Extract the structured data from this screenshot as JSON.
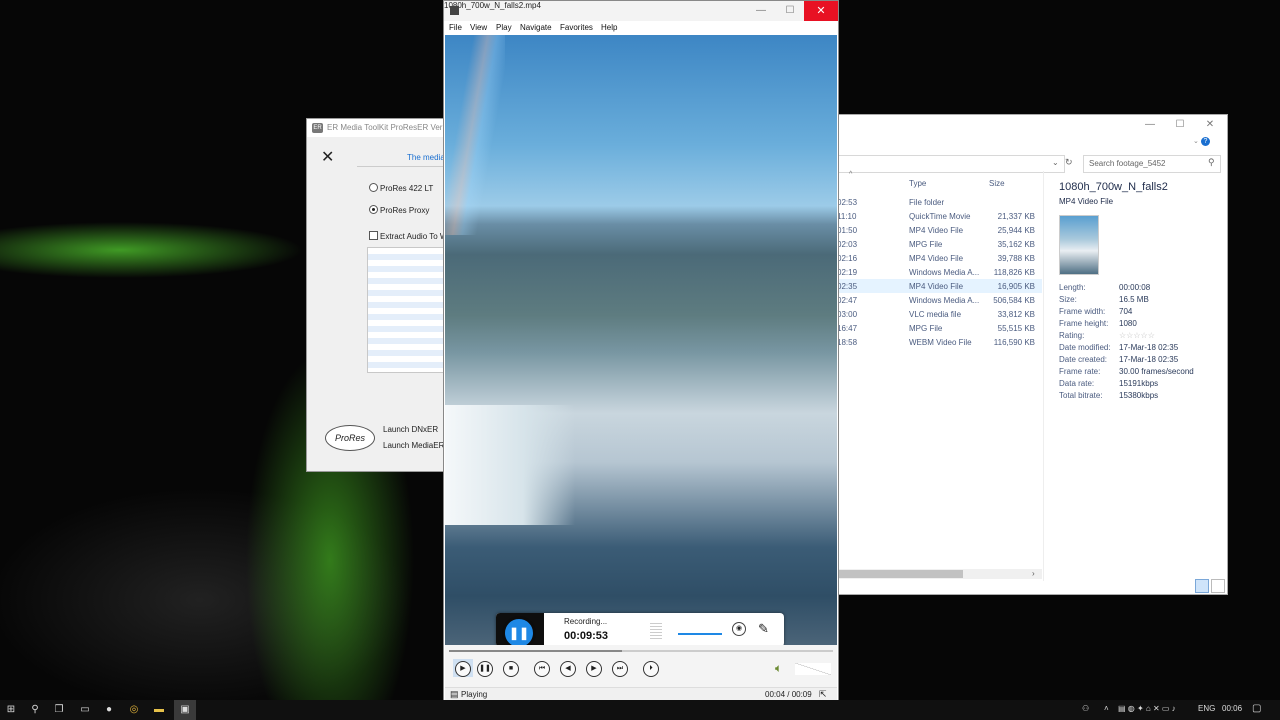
{
  "player": {
    "title": "1080h_700w_N_falls2.mp4",
    "menu": [
      "File",
      "View",
      "Play",
      "Navigate",
      "Favorites",
      "Help"
    ],
    "status": "Playing",
    "time": "00:04 / 00:09",
    "seek_progress": 0.45
  },
  "recorder": {
    "status": "Recording...",
    "elapsed": "00:09:53"
  },
  "er_toolkit": {
    "title": "ER Media ToolKit ProResER  Ver -",
    "subtitle": "The media",
    "options": [
      "ProRes 422 LT",
      "ProRes Proxy"
    ],
    "selected_option": "ProRes Proxy",
    "extract_audio_label": "Extract Audio To W",
    "logo_text": "ProRes",
    "launch_dnxer": "Launch DNxER",
    "launch_mediaer": "Launch MediaER"
  },
  "explorer": {
    "search_placeholder": "Search footage_5452",
    "columns": {
      "type": "Type",
      "size": "Size"
    },
    "rows": [
      {
        "date": "02:53",
        "type": "File folder",
        "size": ""
      },
      {
        "date": "11:10",
        "type": "QuickTime Movie",
        "size": "21,337 KB"
      },
      {
        "date": "01:50",
        "type": "MP4 Video File",
        "size": "25,944 KB"
      },
      {
        "date": "02:03",
        "type": "MPG File",
        "size": "35,162 KB"
      },
      {
        "date": "02:16",
        "type": "MP4 Video File",
        "size": "39,788 KB"
      },
      {
        "date": "02:19",
        "type": "Windows Media A...",
        "size": "118,826 KB"
      },
      {
        "date": "02:35",
        "type": "MP4 Video File",
        "size": "16,905 KB",
        "selected": true
      },
      {
        "date": "02:47",
        "type": "Windows Media A...",
        "size": "506,584 KB"
      },
      {
        "date": "03:00",
        "type": "VLC media file",
        "size": "33,812 KB"
      },
      {
        "date": "16:47",
        "type": "MPG File",
        "size": "55,515 KB"
      },
      {
        "date": "18:58",
        "type": "WEBM Video File",
        "size": "116,590 KB"
      }
    ],
    "details": {
      "file_name": "1080h_700w_N_falls2",
      "file_type": "MP4 Video File",
      "properties": [
        {
          "label": "Length:",
          "value": "00:00:08"
        },
        {
          "label": "Size:",
          "value": "16.5 MB"
        },
        {
          "label": "Frame width:",
          "value": "704"
        },
        {
          "label": "Frame height:",
          "value": "1080"
        },
        {
          "label": "Rating:",
          "value": "☆☆☆☆☆"
        },
        {
          "label": "Date modified:",
          "value": "17-Mar-18 02:35"
        },
        {
          "label": "Date created:",
          "value": "17-Mar-18 02:35"
        },
        {
          "label": "Frame rate:",
          "value": "30.00 frames/second"
        },
        {
          "label": "Data rate:",
          "value": "15191kbps"
        },
        {
          "label": "Total bitrate:",
          "value": "15380kbps"
        }
      ]
    }
  },
  "taskbar": {
    "language": "ENG",
    "clock": "00:06"
  },
  "icons": {
    "start": "windows-icon",
    "search": "search-icon",
    "task_view": "task-view-icon"
  }
}
